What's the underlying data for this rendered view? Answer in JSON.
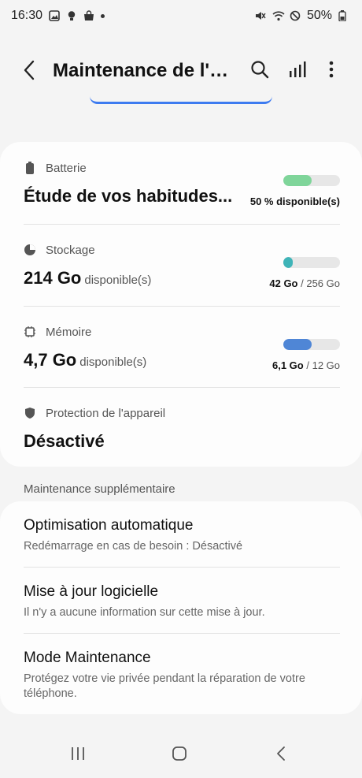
{
  "status_bar": {
    "time": "16:30",
    "battery": "50%",
    "icons": [
      "gallery-icon",
      "bulb-icon",
      "shop-bag-icon",
      "notification-dot",
      "mute-icon",
      "wifi-icon",
      "do-not-disturb-icon",
      "battery-icon"
    ]
  },
  "app_bar": {
    "title": "Maintenance de l'appareil",
    "accent_color": "#3d7bf0"
  },
  "battery": {
    "label": "Batterie",
    "value": "Étude de vos habitudes...",
    "bar_label": "50 % disponible(s)",
    "fill_fraction": 0.5,
    "bar_color": "#7fd59a"
  },
  "storage": {
    "label": "Stockage",
    "value": "214 Go",
    "value_suffix": "disponible(s)",
    "used": "42 Go",
    "total": "/ 256 Go",
    "fill_fraction": 0.16,
    "bar_color": "#3fb4b8"
  },
  "memory": {
    "label": "Mémoire",
    "value": "4,7 Go",
    "value_suffix": "disponible(s)",
    "used": "6,1 Go",
    "total": "/ 12 Go",
    "fill_fraction": 0.5,
    "bar_color": "#4f86d6"
  },
  "protection": {
    "label": "Protection de l'appareil",
    "value": "Désactivé"
  },
  "extra": {
    "header": "Maintenance supplémentaire",
    "items": [
      {
        "title": "Optimisation automatique",
        "subtitle": "Redémarrage en cas de besoin : Désactivé"
      },
      {
        "title": "Mise à jour logicielle",
        "subtitle": "Il n'y a aucune information sur cette mise à jour."
      },
      {
        "title": "Mode Maintenance",
        "subtitle": "Protégez votre vie privée pendant la réparation de votre téléphone."
      }
    ]
  }
}
